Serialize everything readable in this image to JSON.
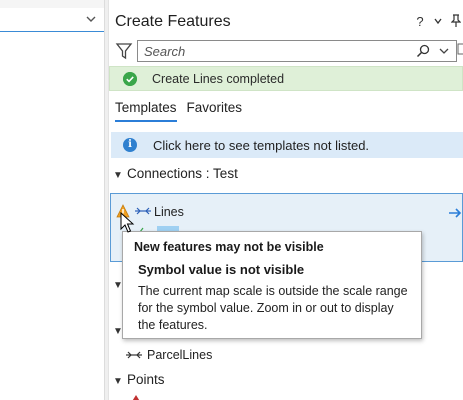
{
  "pane": {
    "title": "Create Features",
    "title_buttons": [
      "?",
      "⌄",
      "📌"
    ],
    "search": {
      "placeholder": "Search",
      "value": ""
    },
    "status": {
      "text": "Create Lines completed",
      "color": "#3aa64a"
    },
    "tabs": [
      {
        "label": "Templates",
        "active": true
      },
      {
        "label": "Favorites",
        "active": false
      }
    ],
    "info": {
      "text": "Click here to see templates not listed."
    },
    "groups": [
      {
        "label": "Connections : Test",
        "expanded": true
      },
      {
        "label": "Points",
        "expanded": true
      }
    ],
    "selected_item": {
      "label": "Lines",
      "icon": "warning-icon"
    },
    "items": [
      {
        "label": "ParcelLines",
        "icon": "parcel-line-icon"
      }
    ]
  },
  "tooltip": {
    "title": "New features may not be visible",
    "heading": "Symbol value is not visible",
    "body": "The current map scale is outside the scale range for the symbol value. Zoom in or out to display the features."
  },
  "colors": {
    "accent": "#2b7ed8",
    "status_bg": "#dff0d8",
    "info_bg": "#dbeaf8",
    "warning": "#f0a020"
  }
}
